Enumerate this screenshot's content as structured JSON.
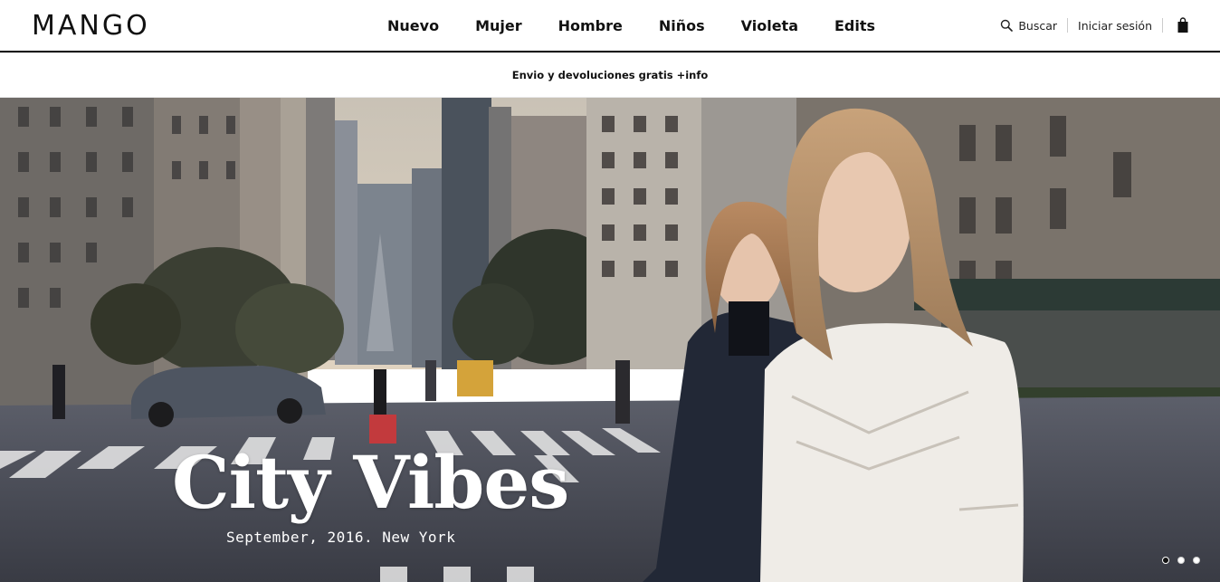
{
  "header": {
    "logo": "MANGO",
    "nav": [
      {
        "label": "Nuevo"
      },
      {
        "label": "Mujer"
      },
      {
        "label": "Hombre"
      },
      {
        "label": "Niños"
      },
      {
        "label": "Violeta"
      },
      {
        "label": "Edits"
      }
    ],
    "search_label": "Buscar",
    "login_label": "Iniciar sesión",
    "bag_icon": "shopping-bag-icon",
    "search_icon": "magnifier-icon"
  },
  "promo": {
    "text": "Envio y devoluciones gratis +info"
  },
  "hero": {
    "title": "City Vibes",
    "subtitle": "September, 2016. New York",
    "slides_total": 3,
    "active_slide": 1
  },
  "colors": {
    "text": "#111111",
    "header_border": "#000000"
  }
}
